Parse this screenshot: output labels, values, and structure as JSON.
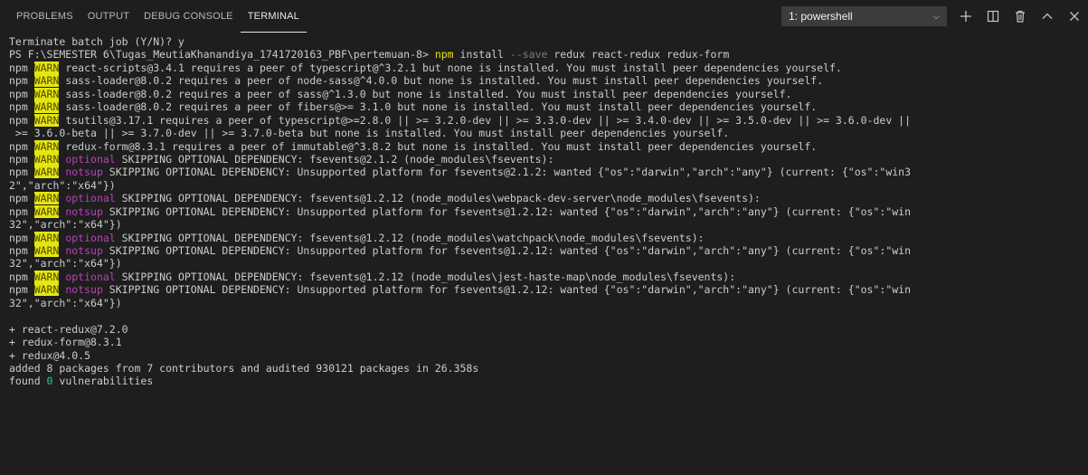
{
  "panel": {
    "tabs": [
      "PROBLEMS",
      "OUTPUT",
      "DEBUG CONSOLE",
      "TERMINAL"
    ],
    "active_tab": "TERMINAL",
    "terminal_select": "1: powershell",
    "actions": [
      "new-terminal",
      "split-terminal",
      "kill-terminal",
      "maximize-panel",
      "close-panel"
    ]
  },
  "colors": {
    "background": "#1e1e1e",
    "text": "#cccccc",
    "warn_bg": "#e5e510",
    "command": "#e5e510",
    "optional": "#bc3fbc",
    "flag": "#7a7a7a",
    "zero": "#23d18b"
  },
  "terminal": {
    "lines": [
      {
        "type": "plain",
        "text": "Terminate batch job (Y/N)? y"
      },
      {
        "type": "prompt",
        "prompt": "PS F:\\SEMESTER 6\\Tugas_MeutiaKhanandiya_1741720163_PBF\\pertemuan-8>",
        "cmd": "npm",
        "rest1": "install",
        "flag": "--save",
        "rest2": "redux react-redux redux-form"
      },
      {
        "type": "warn",
        "text": "react-scripts@3.4.1 requires a peer of typescript@^3.2.1 but none is installed. You must install peer dependencies yourself."
      },
      {
        "type": "warn",
        "text": "sass-loader@8.0.2 requires a peer of node-sass@^4.0.0 but none is installed. You must install peer dependencies yourself."
      },
      {
        "type": "warn",
        "text": "sass-loader@8.0.2 requires a peer of sass@^1.3.0 but none is installed. You must install peer dependencies yourself."
      },
      {
        "type": "warn",
        "text": "sass-loader@8.0.2 requires a peer of fibers@>= 3.1.0 but none is installed. You must install peer dependencies yourself."
      },
      {
        "type": "warn",
        "text": "tsutils@3.17.1 requires a peer of typescript@>=2.8.0 || >= 3.2.0-dev || >= 3.3.0-dev || >= 3.4.0-dev || >= 3.5.0-dev || >= 3.6.0-dev ||"
      },
      {
        "type": "plain",
        "text": " >= 3.6.0-beta || >= 3.7.0-dev || >= 3.7.0-beta but none is installed. You must install peer dependencies yourself."
      },
      {
        "type": "warn",
        "text": "redux-form@8.3.1 requires a peer of immutable@^3.8.2 but none is installed. You must install peer dependencies yourself."
      },
      {
        "type": "warn",
        "tag": "optional",
        "text": "SKIPPING OPTIONAL DEPENDENCY: fsevents@2.1.2 (node_modules\\fsevents):"
      },
      {
        "type": "warn",
        "tag": "notsup",
        "text": "SKIPPING OPTIONAL DEPENDENCY: Unsupported platform for fsevents@2.1.2: wanted {\"os\":\"darwin\",\"arch\":\"any\"} (current: {\"os\":\"win3"
      },
      {
        "type": "plain",
        "text": "2\",\"arch\":\"x64\"})"
      },
      {
        "type": "warn",
        "tag": "optional",
        "text": "SKIPPING OPTIONAL DEPENDENCY: fsevents@1.2.12 (node_modules\\webpack-dev-server\\node_modules\\fsevents):"
      },
      {
        "type": "warn",
        "tag": "notsup",
        "text": "SKIPPING OPTIONAL DEPENDENCY: Unsupported platform for fsevents@1.2.12: wanted {\"os\":\"darwin\",\"arch\":\"any\"} (current: {\"os\":\"win"
      },
      {
        "type": "plain",
        "text": "32\",\"arch\":\"x64\"})"
      },
      {
        "type": "warn",
        "tag": "optional",
        "text": "SKIPPING OPTIONAL DEPENDENCY: fsevents@1.2.12 (node_modules\\watchpack\\node_modules\\fsevents):"
      },
      {
        "type": "warn",
        "tag": "notsup",
        "text": "SKIPPING OPTIONAL DEPENDENCY: Unsupported platform for fsevents@1.2.12: wanted {\"os\":\"darwin\",\"arch\":\"any\"} (current: {\"os\":\"win"
      },
      {
        "type": "plain",
        "text": "32\",\"arch\":\"x64\"})"
      },
      {
        "type": "warn",
        "tag": "optional",
        "text": "SKIPPING OPTIONAL DEPENDENCY: fsevents@1.2.12 (node_modules\\jest-haste-map\\node_modules\\fsevents):"
      },
      {
        "type": "warn",
        "tag": "notsup",
        "text": "SKIPPING OPTIONAL DEPENDENCY: Unsupported platform for fsevents@1.2.12: wanted {\"os\":\"darwin\",\"arch\":\"any\"} (current: {\"os\":\"win"
      },
      {
        "type": "plain",
        "text": "32\",\"arch\":\"x64\"})"
      },
      {
        "type": "plain",
        "text": ""
      },
      {
        "type": "plain",
        "text": "+ react-redux@7.2.0"
      },
      {
        "type": "plain",
        "text": "+ redux-form@8.3.1"
      },
      {
        "type": "plain",
        "text": "+ redux@4.0.5"
      },
      {
        "type": "plain",
        "text": "added 8 packages from 7 contributors and audited 930121 packages in 26.358s"
      },
      {
        "type": "found",
        "pre": "found",
        "num": "0",
        "post": "vulnerabilities"
      }
    ],
    "npm_label": "npm",
    "warn_label": "WARN"
  }
}
